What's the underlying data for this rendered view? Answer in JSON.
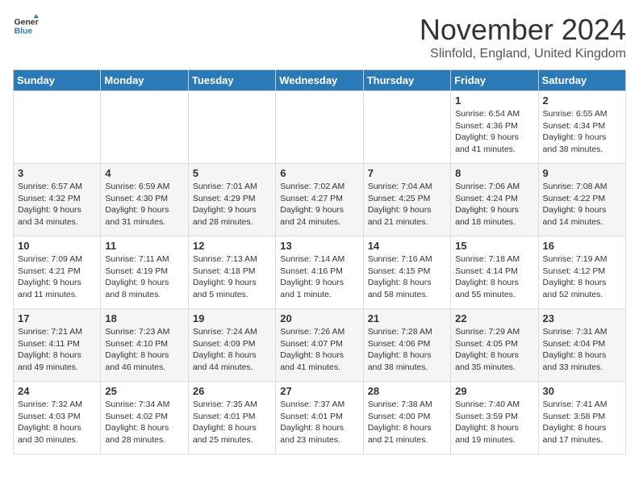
{
  "logo": {
    "general": "General",
    "blue": "Blue"
  },
  "title": "November 2024",
  "location": "Slinfold, England, United Kingdom",
  "weekdays": [
    "Sunday",
    "Monday",
    "Tuesday",
    "Wednesday",
    "Thursday",
    "Friday",
    "Saturday"
  ],
  "weeks": [
    [
      {
        "day": "",
        "info": ""
      },
      {
        "day": "",
        "info": ""
      },
      {
        "day": "",
        "info": ""
      },
      {
        "day": "",
        "info": ""
      },
      {
        "day": "",
        "info": ""
      },
      {
        "day": "1",
        "info": "Sunrise: 6:54 AM\nSunset: 4:36 PM\nDaylight: 9 hours and 41 minutes."
      },
      {
        "day": "2",
        "info": "Sunrise: 6:55 AM\nSunset: 4:34 PM\nDaylight: 9 hours and 38 minutes."
      }
    ],
    [
      {
        "day": "3",
        "info": "Sunrise: 6:57 AM\nSunset: 4:32 PM\nDaylight: 9 hours and 34 minutes."
      },
      {
        "day": "4",
        "info": "Sunrise: 6:59 AM\nSunset: 4:30 PM\nDaylight: 9 hours and 31 minutes."
      },
      {
        "day": "5",
        "info": "Sunrise: 7:01 AM\nSunset: 4:29 PM\nDaylight: 9 hours and 28 minutes."
      },
      {
        "day": "6",
        "info": "Sunrise: 7:02 AM\nSunset: 4:27 PM\nDaylight: 9 hours and 24 minutes."
      },
      {
        "day": "7",
        "info": "Sunrise: 7:04 AM\nSunset: 4:25 PM\nDaylight: 9 hours and 21 minutes."
      },
      {
        "day": "8",
        "info": "Sunrise: 7:06 AM\nSunset: 4:24 PM\nDaylight: 9 hours and 18 minutes."
      },
      {
        "day": "9",
        "info": "Sunrise: 7:08 AM\nSunset: 4:22 PM\nDaylight: 9 hours and 14 minutes."
      }
    ],
    [
      {
        "day": "10",
        "info": "Sunrise: 7:09 AM\nSunset: 4:21 PM\nDaylight: 9 hours and 11 minutes."
      },
      {
        "day": "11",
        "info": "Sunrise: 7:11 AM\nSunset: 4:19 PM\nDaylight: 9 hours and 8 minutes."
      },
      {
        "day": "12",
        "info": "Sunrise: 7:13 AM\nSunset: 4:18 PM\nDaylight: 9 hours and 5 minutes."
      },
      {
        "day": "13",
        "info": "Sunrise: 7:14 AM\nSunset: 4:16 PM\nDaylight: 9 hours and 1 minute."
      },
      {
        "day": "14",
        "info": "Sunrise: 7:16 AM\nSunset: 4:15 PM\nDaylight: 8 hours and 58 minutes."
      },
      {
        "day": "15",
        "info": "Sunrise: 7:18 AM\nSunset: 4:14 PM\nDaylight: 8 hours and 55 minutes."
      },
      {
        "day": "16",
        "info": "Sunrise: 7:19 AM\nSunset: 4:12 PM\nDaylight: 8 hours and 52 minutes."
      }
    ],
    [
      {
        "day": "17",
        "info": "Sunrise: 7:21 AM\nSunset: 4:11 PM\nDaylight: 8 hours and 49 minutes."
      },
      {
        "day": "18",
        "info": "Sunrise: 7:23 AM\nSunset: 4:10 PM\nDaylight: 8 hours and 46 minutes."
      },
      {
        "day": "19",
        "info": "Sunrise: 7:24 AM\nSunset: 4:09 PM\nDaylight: 8 hours and 44 minutes."
      },
      {
        "day": "20",
        "info": "Sunrise: 7:26 AM\nSunset: 4:07 PM\nDaylight: 8 hours and 41 minutes."
      },
      {
        "day": "21",
        "info": "Sunrise: 7:28 AM\nSunset: 4:06 PM\nDaylight: 8 hours and 38 minutes."
      },
      {
        "day": "22",
        "info": "Sunrise: 7:29 AM\nSunset: 4:05 PM\nDaylight: 8 hours and 35 minutes."
      },
      {
        "day": "23",
        "info": "Sunrise: 7:31 AM\nSunset: 4:04 PM\nDaylight: 8 hours and 33 minutes."
      }
    ],
    [
      {
        "day": "24",
        "info": "Sunrise: 7:32 AM\nSunset: 4:03 PM\nDaylight: 8 hours and 30 minutes."
      },
      {
        "day": "25",
        "info": "Sunrise: 7:34 AM\nSunset: 4:02 PM\nDaylight: 8 hours and 28 minutes."
      },
      {
        "day": "26",
        "info": "Sunrise: 7:35 AM\nSunset: 4:01 PM\nDaylight: 8 hours and 25 minutes."
      },
      {
        "day": "27",
        "info": "Sunrise: 7:37 AM\nSunset: 4:01 PM\nDaylight: 8 hours and 23 minutes."
      },
      {
        "day": "28",
        "info": "Sunrise: 7:38 AM\nSunset: 4:00 PM\nDaylight: 8 hours and 21 minutes."
      },
      {
        "day": "29",
        "info": "Sunrise: 7:40 AM\nSunset: 3:59 PM\nDaylight: 8 hours and 19 minutes."
      },
      {
        "day": "30",
        "info": "Sunrise: 7:41 AM\nSunset: 3:58 PM\nDaylight: 8 hours and 17 minutes."
      }
    ]
  ]
}
